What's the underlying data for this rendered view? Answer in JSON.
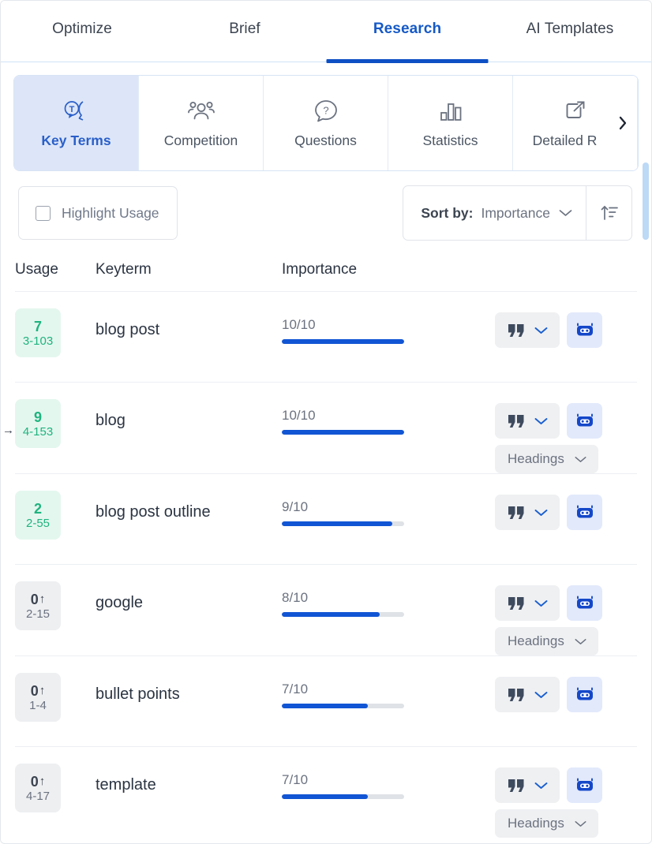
{
  "top_tabs": [
    {
      "label": "Optimize",
      "active": false
    },
    {
      "label": "Brief",
      "active": false
    },
    {
      "label": "Research",
      "active": true
    },
    {
      "label": "AI Templates",
      "active": false
    }
  ],
  "sub_tabs": [
    {
      "label": "Key Terms",
      "icon": "text-bubble-icon",
      "active": true
    },
    {
      "label": "Competition",
      "icon": "people-group-icon",
      "active": false
    },
    {
      "label": "Questions",
      "icon": "question-bubble-icon",
      "active": false
    },
    {
      "label": "Statistics",
      "icon": "bar-chart-icon",
      "active": false
    },
    {
      "label": "Detailed R",
      "icon": "external-link-icon",
      "active": false
    }
  ],
  "sub_tabs_next_icon": "chevron-right-icon",
  "toolbar": {
    "highlight_usage_label": "Highlight Usage",
    "highlight_usage_checked": false,
    "sort_by_label": "Sort by:",
    "sort_value": "Importance",
    "sort_chevron_icon": "chevron-down-icon",
    "sort_direction_icon": "sort-ascending-icon"
  },
  "table": {
    "headers": {
      "usage": "Usage",
      "keyterm": "Keyterm",
      "importance": "Importance"
    },
    "quote_icon": "quote-icon",
    "quote_chevron_icon": "chevron-down-icon",
    "robot_icon": "robot-icon",
    "headings_label": "Headings",
    "headings_chevron_icon": "chevron-down-icon",
    "row_marker": "→",
    "rows": [
      {
        "usage_count": "7",
        "usage_range": "3-103",
        "usage_state": "green",
        "usage_arrow": "",
        "keyterm": "blog post",
        "importance_score": "10/10",
        "importance_value": 10,
        "importance_max": 10,
        "has_headings": false,
        "marked": false
      },
      {
        "usage_count": "9",
        "usage_range": "4-153",
        "usage_state": "green",
        "usage_arrow": "",
        "keyterm": "blog",
        "importance_score": "10/10",
        "importance_value": 10,
        "importance_max": 10,
        "has_headings": true,
        "marked": true
      },
      {
        "usage_count": "2",
        "usage_range": "2-55",
        "usage_state": "green",
        "usage_arrow": "",
        "keyterm": "blog post outline",
        "importance_score": "9/10",
        "importance_value": 9,
        "importance_max": 10,
        "has_headings": false,
        "marked": false
      },
      {
        "usage_count": "0",
        "usage_range": "2-15",
        "usage_state": "gray",
        "usage_arrow": "↑",
        "keyterm": "google",
        "importance_score": "8/10",
        "importance_value": 8,
        "importance_max": 10,
        "has_headings": true,
        "marked": false
      },
      {
        "usage_count": "0",
        "usage_range": "1-4",
        "usage_state": "gray",
        "usage_arrow": "↑",
        "keyterm": "bullet points",
        "importance_score": "7/10",
        "importance_value": 7,
        "importance_max": 10,
        "has_headings": false,
        "marked": false
      },
      {
        "usage_count": "0",
        "usage_range": "4-17",
        "usage_state": "gray",
        "usage_arrow": "↑",
        "keyterm": "template",
        "importance_score": "7/10",
        "importance_value": 7,
        "importance_max": 10,
        "has_headings": true,
        "marked": false
      }
    ]
  },
  "colors": {
    "accent_blue": "#0d4fc4",
    "bar_blue": "#1155d4",
    "bar_track": "#dfe2e6",
    "badge_green_bg": "#e4f7ef",
    "badge_green_text": "#1fb37f",
    "badge_gray_bg": "#eeeff1",
    "active_subtab_bg": "#dde6f8",
    "robot_btn_bg": "#e2e9fb",
    "scrollbar_thumb": "#bcd9f6"
  }
}
